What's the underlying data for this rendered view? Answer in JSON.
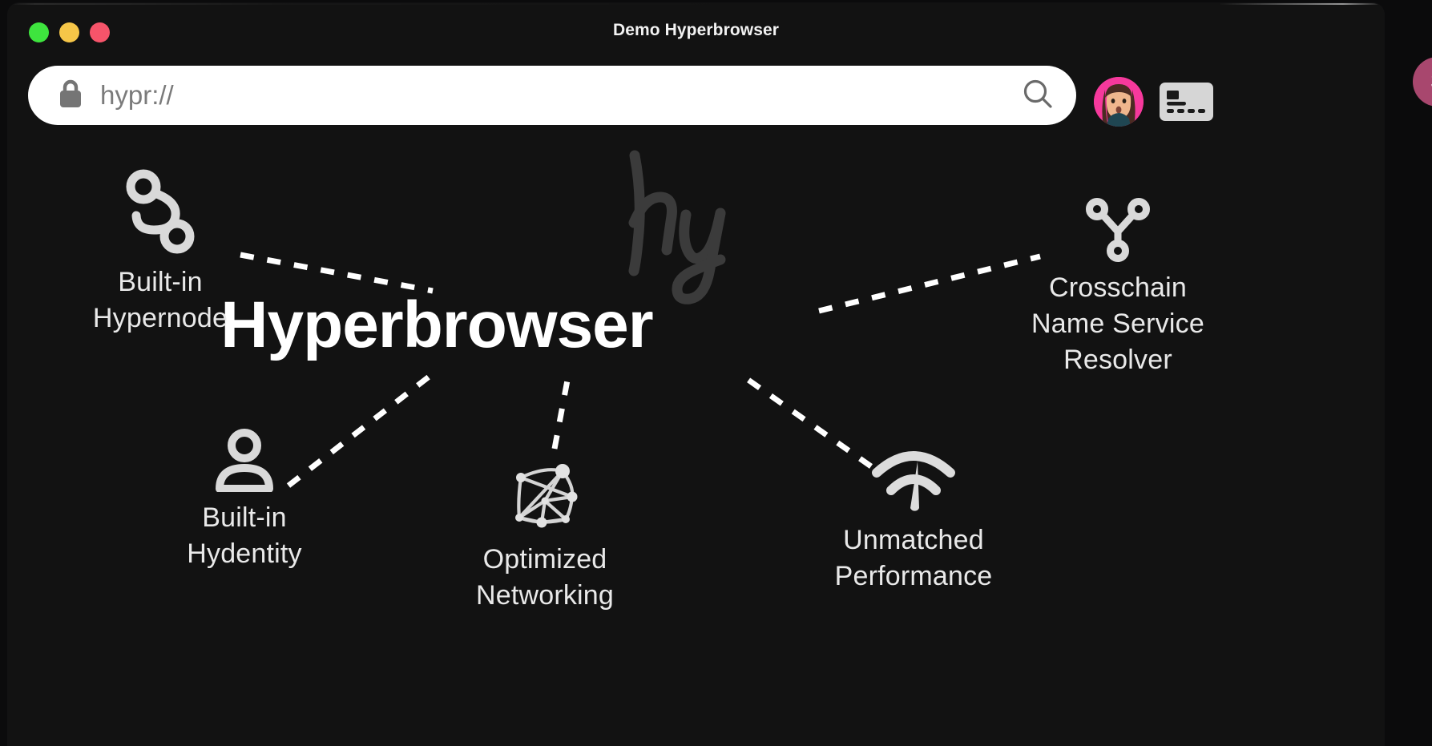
{
  "window": {
    "title": "Demo Hyperbrowser",
    "traffic_lights": [
      {
        "name": "close-button",
        "label": "close",
        "color": "#3ee43e"
      },
      {
        "name": "minimize-button",
        "label": "minimize",
        "color": "#f6c648"
      },
      {
        "name": "maximize-button",
        "label": "maximize",
        "color": "#f6546a"
      }
    ]
  },
  "toolbar": {
    "lock_icon": "lock-icon",
    "url_value": "",
    "url_placeholder": "hypr://",
    "search_icon": "search-icon",
    "avatar_label": "user-avatar",
    "card_icon": "card-icon",
    "edge_badge_text": "$"
  },
  "page": {
    "watermark": "hy",
    "hero_title": "Hyperbrowser",
    "features": [
      {
        "id": "hypernode",
        "icon": "node-link-icon",
        "label": "Built-in\nHypernode"
      },
      {
        "id": "hydentity",
        "icon": "person-icon",
        "label": "Built-in\nHydentity"
      },
      {
        "id": "networking",
        "icon": "network-graph-icon",
        "label": "Optimized\nNetworking"
      },
      {
        "id": "performance",
        "icon": "speedometer-wifi-icon",
        "label": "Unmatched\nPerformance"
      },
      {
        "id": "crosschain",
        "icon": "fork-merge-icon",
        "label": "Crosschain\nName Service\nResolver"
      }
    ]
  },
  "colors": {
    "window_bg": "#121212",
    "desktop_bg": "#0b0b0c",
    "address_bar_bg": "#ffffff",
    "text_primary": "#ffffff",
    "text_secondary": "#e9e9e9",
    "watermark": "#3a3a3a",
    "accent_pink": "#f6399c",
    "edge_badge": "#a8476e"
  }
}
